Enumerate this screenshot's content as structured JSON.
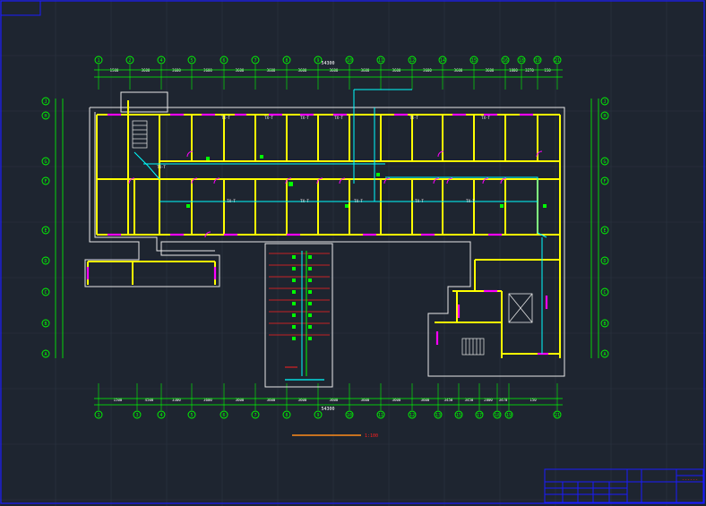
{
  "drawing": {
    "colors": {
      "background": "#1e2530",
      "grid": "#2c3542",
      "frame": "#1a1aff",
      "axis": "#00ff00",
      "wall": "#ffff00",
      "wall_outline": "#e8e8e8",
      "door": "#ff00ff",
      "pipe": "#00ffff",
      "red": "#ff2020",
      "orange": "#ff8c1a"
    },
    "axes_top": [
      "1",
      "2",
      "4",
      "5",
      "6",
      "7",
      "8",
      "9",
      "10",
      "11",
      "12",
      "14",
      "15",
      "16",
      "18",
      "19",
      "21"
    ],
    "axes_bottom": [
      "1",
      "3",
      "4",
      "5",
      "6",
      "7",
      "8",
      "9",
      "10",
      "11",
      "12",
      "13",
      "15",
      "17",
      "18",
      "19",
      "21"
    ],
    "axes_left": [
      "J",
      "H",
      "G",
      "F",
      "E",
      "D",
      "C",
      "B",
      "A"
    ],
    "axes_right": [
      "J",
      "H",
      "G",
      "F",
      "E",
      "D",
      "C",
      "B",
      "A"
    ],
    "dims_top": [
      "1500",
      "3600",
      "3600",
      "3600",
      "3600",
      "3600",
      "3600",
      "3600",
      "3600",
      "3600",
      "3600",
      "3600",
      "3600",
      "1800",
      "3270",
      "150"
    ],
    "dims_bottom": [
      "1500",
      "4500",
      "3300",
      "3600",
      "3600",
      "3600",
      "3600",
      "3600",
      "3600",
      "3600",
      "3600",
      "3450",
      "3450",
      "2800",
      "3470",
      "150"
    ],
    "overall_top": "54300",
    "overall_bottom": "54300",
    "scale_label": "1:100",
    "room_tags": [
      "TX-T",
      "TX-T",
      "TX-T",
      "TX-T",
      "TX-T",
      "TX-T",
      "TX-T",
      "TX-T",
      "TX-T",
      "TX-T",
      "TX-T",
      "TX-T"
    ],
    "title_block_label": "------"
  }
}
